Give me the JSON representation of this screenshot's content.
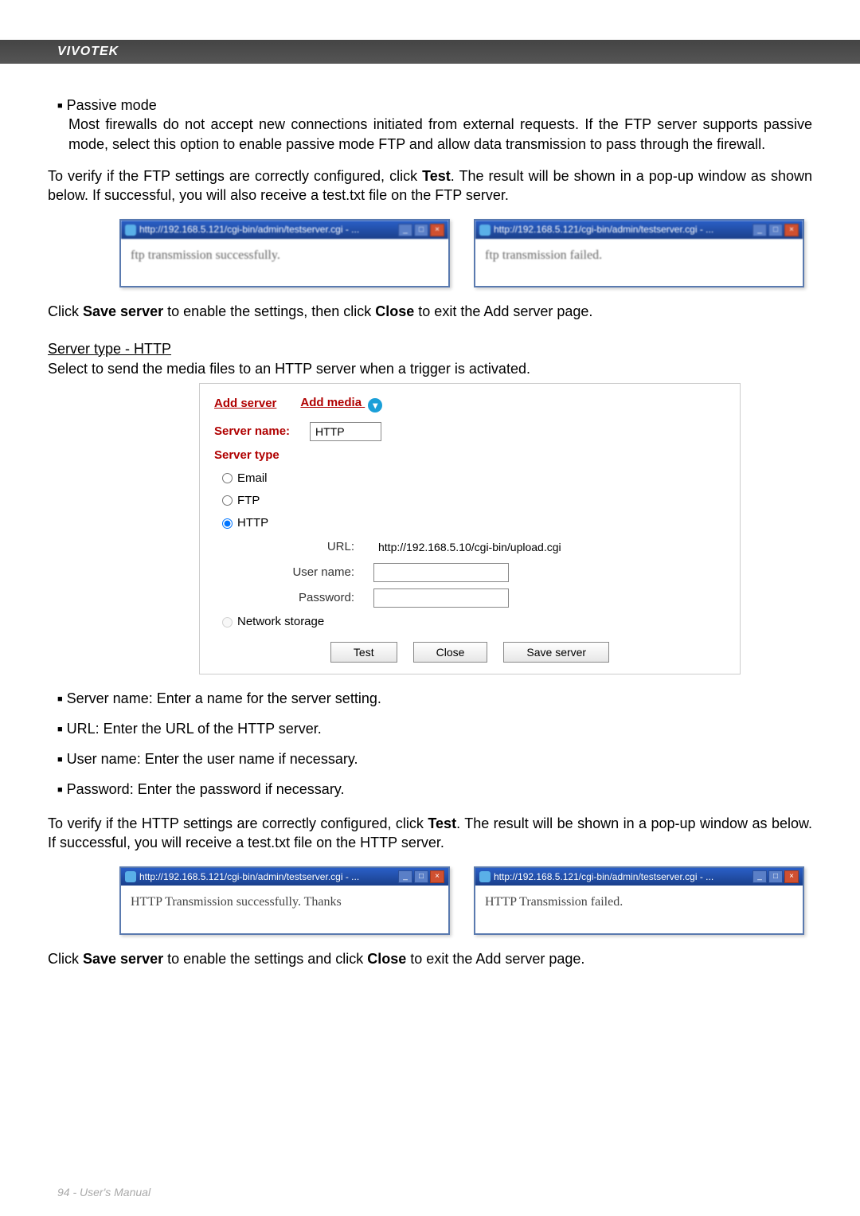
{
  "header": {
    "brand": "VIVOTEK"
  },
  "section1": {
    "bullet_title": "Passive mode",
    "bullet_body": "Most firewalls do not accept new connections initiated from external requests. If the FTP server supports passive mode, select this option to enable passive mode FTP and allow data transmission to pass through the firewall.",
    "verify_pre": "To verify if the FTP settings are correctly configured, click ",
    "verify_bold": "Test",
    "verify_post": ". The result will be shown in a pop-up window as shown below. If successful, you will also receive a test.txt file on the FTP server.",
    "popup_left_title": "http://192.168.5.121/cgi-bin/admin/testserver.cgi - ...",
    "popup_left_body": "ftp transmission successfully.",
    "popup_right_title": "http://192.168.5.121/cgi-bin/admin/testserver.cgi - ...",
    "popup_right_body": "ftp transmission failed.",
    "save_pre": "Click ",
    "save_b1": "Save server",
    "save_mid": " to enable the settings, then click ",
    "save_b2": "Close",
    "save_post": " to exit the Add server page."
  },
  "section2": {
    "heading": "Server type - HTTP",
    "intro": "Select to send the media files to an HTTP server when a trigger is activated.",
    "panel": {
      "tab_add_server": "Add server",
      "tab_add_media": "Add media",
      "server_name_label": "Server name:",
      "server_name_value": "HTTP",
      "server_type_label": "Server type",
      "opt_email": "Email",
      "opt_ftp": "FTP",
      "opt_http": "HTTP",
      "url_label": "URL:",
      "url_value": "http://192.168.5.10/cgi-bin/upload.cgi",
      "username_label": "User name:",
      "username_value": "",
      "password_label": "Password:",
      "password_value": "",
      "opt_netstorage": "Network storage",
      "btn_test": "Test",
      "btn_close": "Close",
      "btn_save": "Save server"
    },
    "bullets": {
      "b1": "Server name: Enter a name for the server setting.",
      "b2": "URL: Enter the URL of the HTTP server.",
      "b3": "User name: Enter the user name if necessary.",
      "b4": "Password: Enter the password if necessary."
    },
    "verify_pre": "To verify if the HTTP settings are correctly configured, click ",
    "verify_bold": "Test",
    "verify_post": ". The result will be shown in a pop-up window as below. If successful, you will receive a test.txt file on the HTTP server.",
    "popup_left_title": "http://192.168.5.121/cgi-bin/admin/testserver.cgi - ...",
    "popup_left_body": "HTTP Transmission successfully. Thanks",
    "popup_right_title": "http://192.168.5.121/cgi-bin/admin/testserver.cgi - ...",
    "popup_right_body": "HTTP Transmission failed.",
    "save_pre": "Click ",
    "save_b1": "Save server",
    "save_mid": " to enable the settings and click ",
    "save_b2": "Close",
    "save_post": " to exit the Add server page."
  },
  "footer": {
    "text": "94 - User's Manual"
  }
}
